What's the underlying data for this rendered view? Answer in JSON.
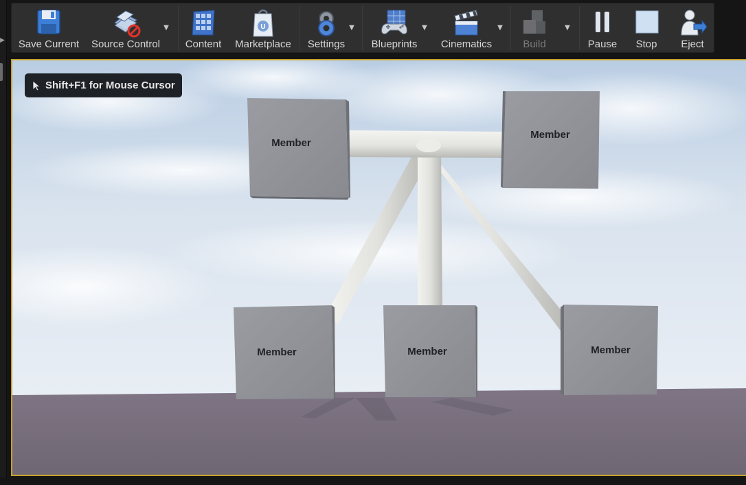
{
  "toolbar": {
    "save_current": "Save Current",
    "source_control": "Source Control",
    "content": "Content",
    "marketplace": "Marketplace",
    "settings": "Settings",
    "blueprints": "Blueprints",
    "cinematics": "Cinematics",
    "build": "Build",
    "pause": "Pause",
    "stop": "Stop",
    "eject": "Eject"
  },
  "viewport": {
    "hint": "Shift+F1 for Mouse Cursor",
    "blocks": [
      {
        "label": "Member"
      },
      {
        "label": "Member"
      },
      {
        "label": "Member"
      },
      {
        "label": "Member"
      },
      {
        "label": "Member"
      }
    ]
  },
  "colors": {
    "viewport_border": "#c9a228",
    "toolbar_bg": "#2f2f2f",
    "block": "#8e9096",
    "beam": "#e2e2df",
    "floor": "#7d7280"
  },
  "icons": [
    "save-icon",
    "source-control-icon",
    "content-icon",
    "marketplace-icon",
    "settings-icon",
    "blueprints-icon",
    "cinematics-icon",
    "build-icon",
    "pause-icon",
    "stop-icon",
    "eject-icon",
    "cursor-icon"
  ]
}
